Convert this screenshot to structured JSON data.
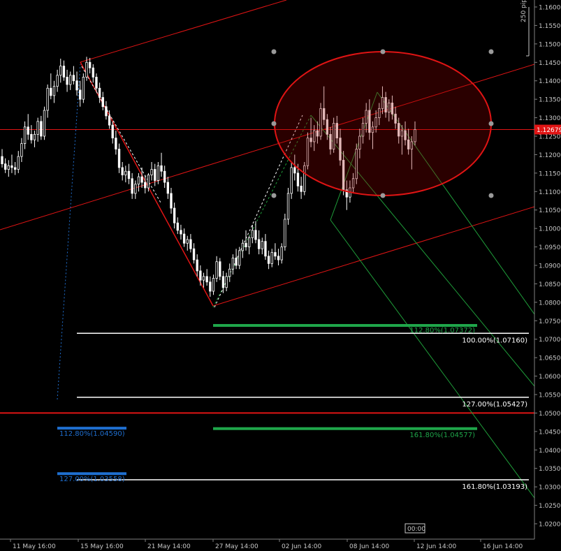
{
  "chart_data": {
    "type": "candlestick",
    "symbol_scale_label": "250 pip",
    "current_price": "1.12679",
    "ylim": [
      1.0185,
      1.167
    ],
    "y_ticks": [
      "1.16000",
      "1.15500",
      "1.15000",
      "1.14500",
      "1.14000",
      "1.13500",
      "1.13000",
      "1.12500",
      "1.12000",
      "1.11500",
      "1.11000",
      "1.10500",
      "1.10000",
      "1.09500",
      "1.09000",
      "1.08500",
      "1.08000",
      "1.07500",
      "1.07000",
      "1.06500",
      "1.06000",
      "1.05500",
      "1.05000",
      "1.04500",
      "1.04000",
      "1.03500",
      "1.03000",
      "1.02500",
      "1.02000"
    ],
    "y_tick_values": [
      1.16,
      1.155,
      1.15,
      1.145,
      1.14,
      1.135,
      1.13,
      1.125,
      1.12,
      1.115,
      1.11,
      1.105,
      1.1,
      1.095,
      1.09,
      1.085,
      1.08,
      1.075,
      1.07,
      1.065,
      1.06,
      1.055,
      1.05,
      1.045,
      1.04,
      1.035,
      1.03,
      1.025,
      1.02
    ],
    "x_ticks": [
      "11 May 16:00",
      "15 May 16:00",
      "21 May 14:00",
      "27 May 14:00",
      "02 Jun 14:00",
      "08 Jun 14:00",
      "12 Jun 14:00",
      "16 Jun 14:00"
    ],
    "x_tick_index": [
      0,
      1,
      2,
      3,
      4,
      5,
      6,
      7
    ],
    "cursor_time_label": "00:00",
    "horizontal_lines": [
      {
        "value": 1.12679,
        "color": "#e01414"
      },
      {
        "value": 1.05,
        "color": "#e01414"
      }
    ],
    "fib_levels": [
      {
        "label": "100.00%(1.07160)",
        "value": 1.0716,
        "color": "#ffffff",
        "label_color": "#ffffff"
      },
      {
        "label": "127.00%(1.05427)",
        "value": 1.05427,
        "color": "#ffffff",
        "label_color": "#ffffff"
      },
      {
        "label": "161.80%(1.03193)",
        "value": 1.03193,
        "color": "#ffffff",
        "label_color": "#ffffff"
      },
      {
        "label": "112.80%(1.07372)",
        "value": 1.07372,
        "color": "#1fa64a",
        "label_color": "#1fa64a"
      },
      {
        "label": "161.80%(1.04577)",
        "value": 1.04577,
        "color": "#1fa64a",
        "label_color": "#1fa64a"
      },
      {
        "label": "112.80%(1.04590)",
        "value": 1.0459,
        "color": "#1f6fd0",
        "label_color": "#1f6fd0"
      },
      {
        "label": "127.00%(1.03558)",
        "value": 1.03358,
        "color": "#1f6fd0",
        "label_color": "#1f6fd0"
      }
    ],
    "colors": {
      "background": "#000000",
      "candle": "#ffffff",
      "trend_red": "#e01414",
      "pitchfork_green": "#1f9e3a",
      "fib_blue": "#1f6fd0",
      "axis_text": "#c8c8c8"
    },
    "candles": [
      [
        1.1195,
        1.1215,
        1.1165,
        1.1175
      ],
      [
        1.1175,
        1.119,
        1.115,
        1.116
      ],
      [
        1.116,
        1.1185,
        1.114,
        1.117
      ],
      [
        1.117,
        1.12,
        1.115,
        1.1165
      ],
      [
        1.1165,
        1.118,
        1.1145,
        1.116
      ],
      [
        1.116,
        1.121,
        1.115,
        1.1195
      ],
      [
        1.1195,
        1.1245,
        1.118,
        1.123
      ],
      [
        1.123,
        1.129,
        1.1215,
        1.1275
      ],
      [
        1.1275,
        1.131,
        1.124,
        1.1255
      ],
      [
        1.1255,
        1.128,
        1.123,
        1.124
      ],
      [
        1.124,
        1.1265,
        1.122,
        1.1255
      ],
      [
        1.1255,
        1.13,
        1.1235,
        1.129
      ],
      [
        1.129,
        1.1305,
        1.124,
        1.125
      ],
      [
        1.125,
        1.133,
        1.124,
        1.132
      ],
      [
        1.132,
        1.139,
        1.13,
        1.138
      ],
      [
        1.138,
        1.142,
        1.135,
        1.136
      ],
      [
        1.136,
        1.14,
        1.134,
        1.1385
      ],
      [
        1.1385,
        1.143,
        1.137,
        1.1415
      ],
      [
        1.1415,
        1.146,
        1.1395,
        1.144
      ],
      [
        1.144,
        1.1455,
        1.14,
        1.141
      ],
      [
        1.141,
        1.143,
        1.137,
        1.139
      ],
      [
        1.139,
        1.1425,
        1.1375,
        1.1415
      ],
      [
        1.1415,
        1.144,
        1.139,
        1.14
      ],
      [
        1.14,
        1.1425,
        1.136,
        1.1375
      ],
      [
        1.1375,
        1.14,
        1.133,
        1.135
      ],
      [
        1.135,
        1.142,
        1.134,
        1.141
      ],
      [
        1.141,
        1.1465,
        1.14,
        1.145
      ],
      [
        1.145,
        1.1462,
        1.142,
        1.1435
      ],
      [
        1.1435,
        1.1445,
        1.1395,
        1.141
      ],
      [
        1.141,
        1.142,
        1.137,
        1.138
      ],
      [
        1.138,
        1.1395,
        1.134,
        1.1355
      ],
      [
        1.1355,
        1.137,
        1.132,
        1.133
      ],
      [
        1.133,
        1.1345,
        1.1295,
        1.1305
      ],
      [
        1.1305,
        1.132,
        1.127,
        1.128
      ],
      [
        1.128,
        1.129,
        1.123,
        1.1245
      ],
      [
        1.1245,
        1.1265,
        1.12,
        1.1215
      ],
      [
        1.1215,
        1.123,
        1.115,
        1.1165
      ],
      [
        1.1165,
        1.118,
        1.113,
        1.1145
      ],
      [
        1.1145,
        1.117,
        1.1125,
        1.1155
      ],
      [
        1.1155,
        1.1175,
        1.112,
        1.1135
      ],
      [
        1.1135,
        1.115,
        1.108,
        1.1095
      ],
      [
        1.1095,
        1.113,
        1.108,
        1.112
      ],
      [
        1.112,
        1.115,
        1.11,
        1.114
      ],
      [
        1.114,
        1.1165,
        1.111,
        1.1125
      ],
      [
        1.1125,
        1.1145,
        1.1095,
        1.111
      ],
      [
        1.111,
        1.115,
        1.11,
        1.1145
      ],
      [
        1.1145,
        1.118,
        1.113,
        1.116
      ],
      [
        1.116,
        1.1175,
        1.1115,
        1.113
      ],
      [
        1.113,
        1.118,
        1.112,
        1.117
      ],
      [
        1.117,
        1.1205,
        1.114,
        1.1155
      ],
      [
        1.1155,
        1.117,
        1.111,
        1.1125
      ],
      [
        1.1125,
        1.114,
        1.108,
        1.1095
      ],
      [
        1.1095,
        1.111,
        1.104,
        1.1055
      ],
      [
        1.1055,
        1.107,
        1.1,
        1.1015
      ],
      [
        1.1015,
        1.103,
        1.0985,
        1.0995
      ],
      [
        1.0995,
        1.101,
        1.097,
        1.0985
      ],
      [
        1.0985,
        1.1,
        1.095,
        1.096
      ],
      [
        1.096,
        1.098,
        1.094,
        1.097
      ],
      [
        1.097,
        1.0985,
        1.0935,
        1.0945
      ],
      [
        1.0945,
        1.096,
        1.0905,
        1.0915
      ],
      [
        1.0915,
        1.093,
        1.087,
        1.0885
      ],
      [
        1.0885,
        1.09,
        1.0845,
        1.086
      ],
      [
        1.086,
        1.088,
        1.084,
        1.087
      ],
      [
        1.087,
        1.089,
        1.0845,
        1.0855
      ],
      [
        1.0855,
        1.087,
        1.0815,
        1.083
      ],
      [
        1.083,
        1.0875,
        1.082,
        1.0865
      ],
      [
        1.0865,
        1.0925,
        1.0855,
        1.091
      ],
      [
        1.091,
        1.092,
        1.086,
        1.087
      ],
      [
        1.087,
        1.0885,
        1.0825,
        1.084
      ],
      [
        1.084,
        1.088,
        1.083,
        1.087
      ],
      [
        1.087,
        1.0905,
        1.0855,
        1.089
      ],
      [
        1.089,
        1.093,
        1.0875,
        1.092
      ],
      [
        1.092,
        1.0945,
        1.089,
        1.09
      ],
      [
        1.09,
        1.095,
        1.089,
        1.094
      ],
      [
        1.094,
        1.097,
        1.092,
        1.096
      ],
      [
        1.096,
        1.0995,
        1.094,
        1.095
      ],
      [
        1.095,
        1.098,
        1.093,
        1.0975
      ],
      [
        1.0975,
        1.101,
        1.096,
        1.0995
      ],
      [
        1.0995,
        1.102,
        1.096,
        1.097
      ],
      [
        1.097,
        1.0995,
        1.093,
        1.0945
      ],
      [
        1.0945,
        1.0975,
        1.093,
        1.0965
      ],
      [
        1.0965,
        1.0985,
        1.0915,
        1.0925
      ],
      [
        1.0925,
        1.094,
        1.089,
        1.0905
      ],
      [
        1.0905,
        1.0945,
        1.0895,
        1.0935
      ],
      [
        1.0935,
        1.096,
        1.0915,
        1.0925
      ],
      [
        1.0925,
        1.0945,
        1.09,
        1.0915
      ],
      [
        1.0915,
        1.096,
        1.0905,
        1.095
      ],
      [
        1.095,
        1.104,
        1.094,
        1.1025
      ],
      [
        1.1025,
        1.111,
        1.101,
        1.1095
      ],
      [
        1.1095,
        1.118,
        1.108,
        1.1165
      ],
      [
        1.1165,
        1.12,
        1.113,
        1.115
      ],
      [
        1.115,
        1.1175,
        1.11,
        1.1115
      ],
      [
        1.1115,
        1.114,
        1.108,
        1.11
      ],
      [
        1.11,
        1.118,
        1.109,
        1.117
      ],
      [
        1.117,
        1.126,
        1.116,
        1.1245
      ],
      [
        1.1245,
        1.13,
        1.122,
        1.1235
      ],
      [
        1.1235,
        1.128,
        1.121,
        1.1265
      ],
      [
        1.1265,
        1.129,
        1.123,
        1.125
      ],
      [
        1.125,
        1.134,
        1.124,
        1.1325
      ],
      [
        1.1325,
        1.1385,
        1.128,
        1.1295
      ],
      [
        1.1295,
        1.131,
        1.124,
        1.1255
      ],
      [
        1.1255,
        1.1275,
        1.12,
        1.1215
      ],
      [
        1.1215,
        1.13,
        1.1205,
        1.1285
      ],
      [
        1.1285,
        1.1305,
        1.123,
        1.1245
      ],
      [
        1.1245,
        1.127,
        1.117,
        1.1185
      ],
      [
        1.1185,
        1.121,
        1.109,
        1.1105
      ],
      [
        1.1105,
        1.113,
        1.105,
        1.1085
      ],
      [
        1.1085,
        1.113,
        1.107,
        1.111
      ],
      [
        1.111,
        1.115,
        1.1095,
        1.1135
      ],
      [
        1.1135,
        1.123,
        1.112,
        1.1215
      ],
      [
        1.1215,
        1.127,
        1.119,
        1.125
      ],
      [
        1.125,
        1.13,
        1.123,
        1.1285
      ],
      [
        1.1285,
        1.134,
        1.126,
        1.132
      ],
      [
        1.132,
        1.135,
        1.124,
        1.126
      ],
      [
        1.126,
        1.129,
        1.1215,
        1.1275
      ],
      [
        1.1275,
        1.132,
        1.126,
        1.13
      ],
      [
        1.13,
        1.134,
        1.128,
        1.1325
      ],
      [
        1.1325,
        1.1385,
        1.131,
        1.1355
      ],
      [
        1.1355,
        1.137,
        1.13,
        1.1315
      ],
      [
        1.1315,
        1.135,
        1.129,
        1.134
      ],
      [
        1.134,
        1.136,
        1.1295,
        1.131
      ],
      [
        1.131,
        1.133,
        1.127,
        1.1285
      ],
      [
        1.1285,
        1.13,
        1.123,
        1.125
      ],
      [
        1.125,
        1.128,
        1.12,
        1.1265
      ],
      [
        1.1265,
        1.129,
        1.1225,
        1.124
      ],
      [
        1.124,
        1.127,
        1.12,
        1.1215
      ],
      [
        1.1215,
        1.125,
        1.116,
        1.1235
      ],
      [
        1.1235,
        1.129,
        1.1225,
        1.1268
      ]
    ]
  }
}
